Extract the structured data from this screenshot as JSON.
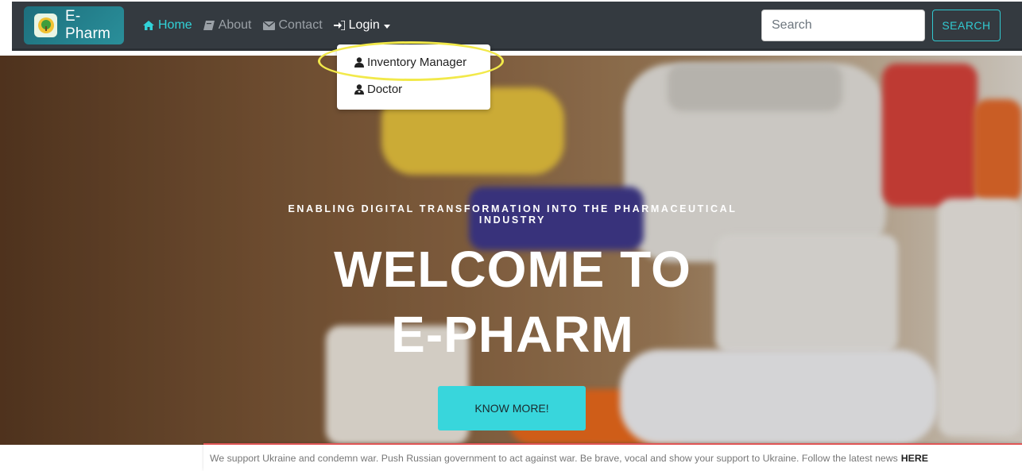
{
  "navbar": {
    "brand": "E-Pharm",
    "items": [
      {
        "label": "Home",
        "icon": "home-icon"
      },
      {
        "label": "About",
        "icon": "book-icon"
      },
      {
        "label": "Contact",
        "icon": "envelope-icon"
      },
      {
        "label": "Login",
        "icon": "sign-in-icon"
      }
    ],
    "search_placeholder": "Search",
    "search_button": "SEARCH"
  },
  "dropdown": {
    "items": [
      {
        "label": "Inventory Manager",
        "icon": "user-icon"
      },
      {
        "label": "Doctor",
        "icon": "user-doctor-icon"
      }
    ]
  },
  "hero": {
    "tagline_line1": "ENABLING DIGITAL TRANSFORMATION INTO THE PHARMACEUTICAL",
    "tagline_line2": "INDUSTRY",
    "title_line1": "WELCOME TO",
    "title_line2": "E-PHARM",
    "cta": "KNOW MORE!"
  },
  "notice": {
    "text": "We support Ukraine and condemn war. Push Russian government to act against war. Be brave, vocal and show your support to Ukraine. Follow the latest news",
    "link": "HERE"
  },
  "colors": {
    "accent": "#31d2d8",
    "navbar": "#343a40",
    "highlight": "#f2e94a"
  }
}
